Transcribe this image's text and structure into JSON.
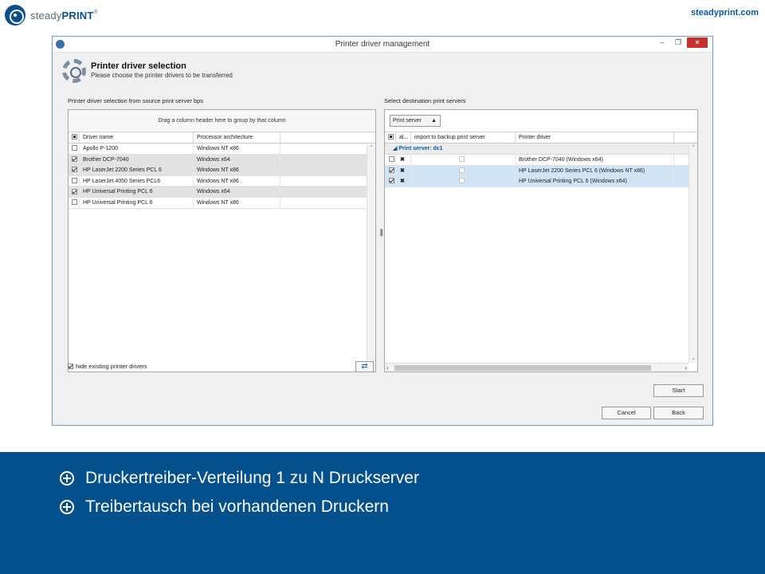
{
  "brand": {
    "word_light": "steady",
    "word_bold": "PRINT",
    "tm": "®",
    "site": "steadyprint.com"
  },
  "window": {
    "title": "Printer driver management",
    "controls": {
      "minimize": "–",
      "maximize": "❐",
      "close": "×"
    },
    "header": {
      "title": "Printer driver selection",
      "subtitle": "Please choose the printer drivers to be transferred"
    }
  },
  "left": {
    "label": "Printer driver selection from source print server bps",
    "group_hint": "Drag a column header here to group by that column",
    "columns": [
      "Driver name",
      "Processor architecture"
    ],
    "rows": [
      {
        "checked": false,
        "name": "Apollo P-1200",
        "arch": "Windows NT x86",
        "selected": false
      },
      {
        "checked": true,
        "name": "Brother DCP-7040",
        "arch": "Windows x64",
        "selected": true
      },
      {
        "checked": true,
        "name": "HP LaserJet 2200 Series PCL 6",
        "arch": "Windows NT x86",
        "selected": true
      },
      {
        "checked": false,
        "name": "HP LaserJet 4050 Series PCL6",
        "arch": "Windows NT x86",
        "selected": false
      },
      {
        "checked": true,
        "name": "HP Universal Printing PCL 6",
        "arch": "Windows x64",
        "selected": true
      },
      {
        "checked": false,
        "name": "HP Universal Printing PCL 6",
        "arch": "Windows NT x86",
        "selected": false
      }
    ],
    "hide_existing_label": "hide existing printer drivers",
    "hide_existing_checked": true,
    "refresh_icon": "⇄"
  },
  "right": {
    "label": "Select destination print servers",
    "groupby_value": "Print server",
    "columns": [
      "al...",
      "import to backup print server",
      "Printer driver"
    ],
    "group": "Print server: dc1",
    "rows": [
      {
        "checked": false,
        "action": "✖",
        "backup": false,
        "driver": "Brother DCP-7040 (Windows x64)",
        "highlight": false
      },
      {
        "checked": true,
        "action": "✖",
        "backup": false,
        "driver": "HP LaserJet 2200 Series PCL 6 (Windows NT x86)",
        "highlight": true
      },
      {
        "checked": true,
        "action": "✖",
        "backup": false,
        "driver": "HP Universal Printing PCL 6 (Windows x64)",
        "highlight": true
      }
    ]
  },
  "buttons": {
    "start": "Start",
    "cancel": "Cancel",
    "back": "Back"
  },
  "bullets": [
    "Druckertreiber-Verteilung 1 zu N Druckserver",
    "Treibertausch bei vorhandenen Druckern"
  ],
  "colors": {
    "band": "#03508c",
    "accent": "#0a5a9c",
    "close": "#c8302c",
    "highlight": "#cfe5f6"
  }
}
